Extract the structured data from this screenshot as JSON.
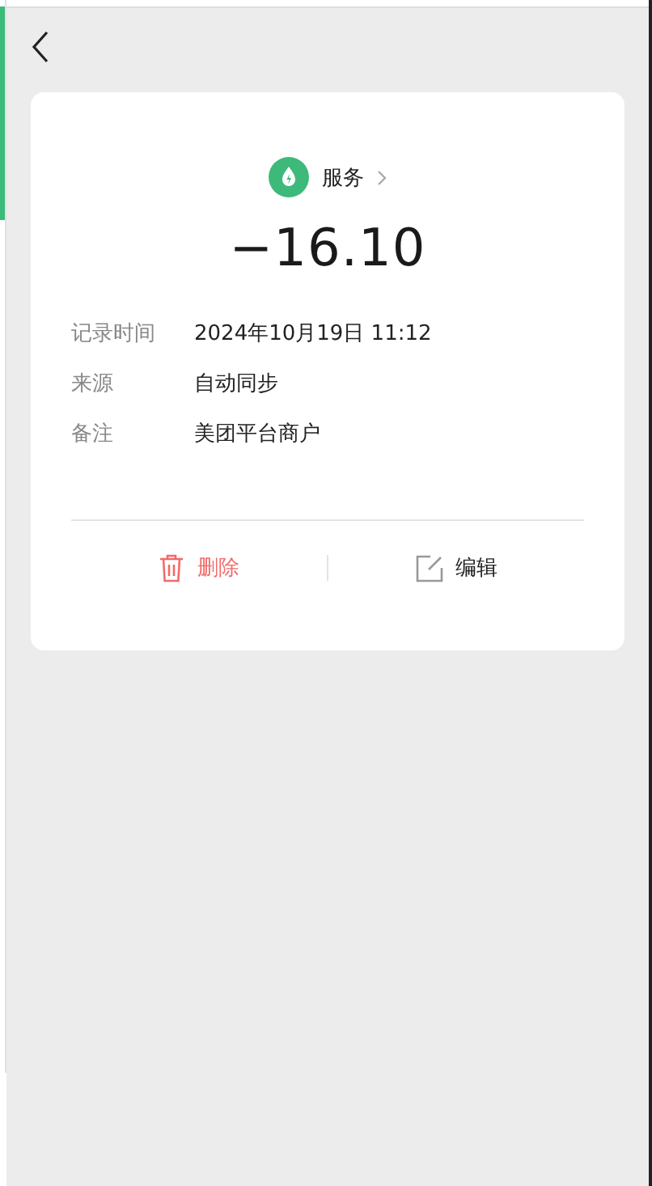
{
  "category": {
    "label": "服务"
  },
  "amount": "−16.10",
  "details": [
    {
      "label": "记录时间",
      "value": "2024年10月19日 11:12"
    },
    {
      "label": "来源",
      "value": "自动同步"
    },
    {
      "label": "备注",
      "value": "美团平台商户"
    }
  ],
  "actions": [
    {
      "kind": "delete",
      "label": "删除"
    },
    {
      "kind": "edit",
      "label": "编辑"
    }
  ]
}
